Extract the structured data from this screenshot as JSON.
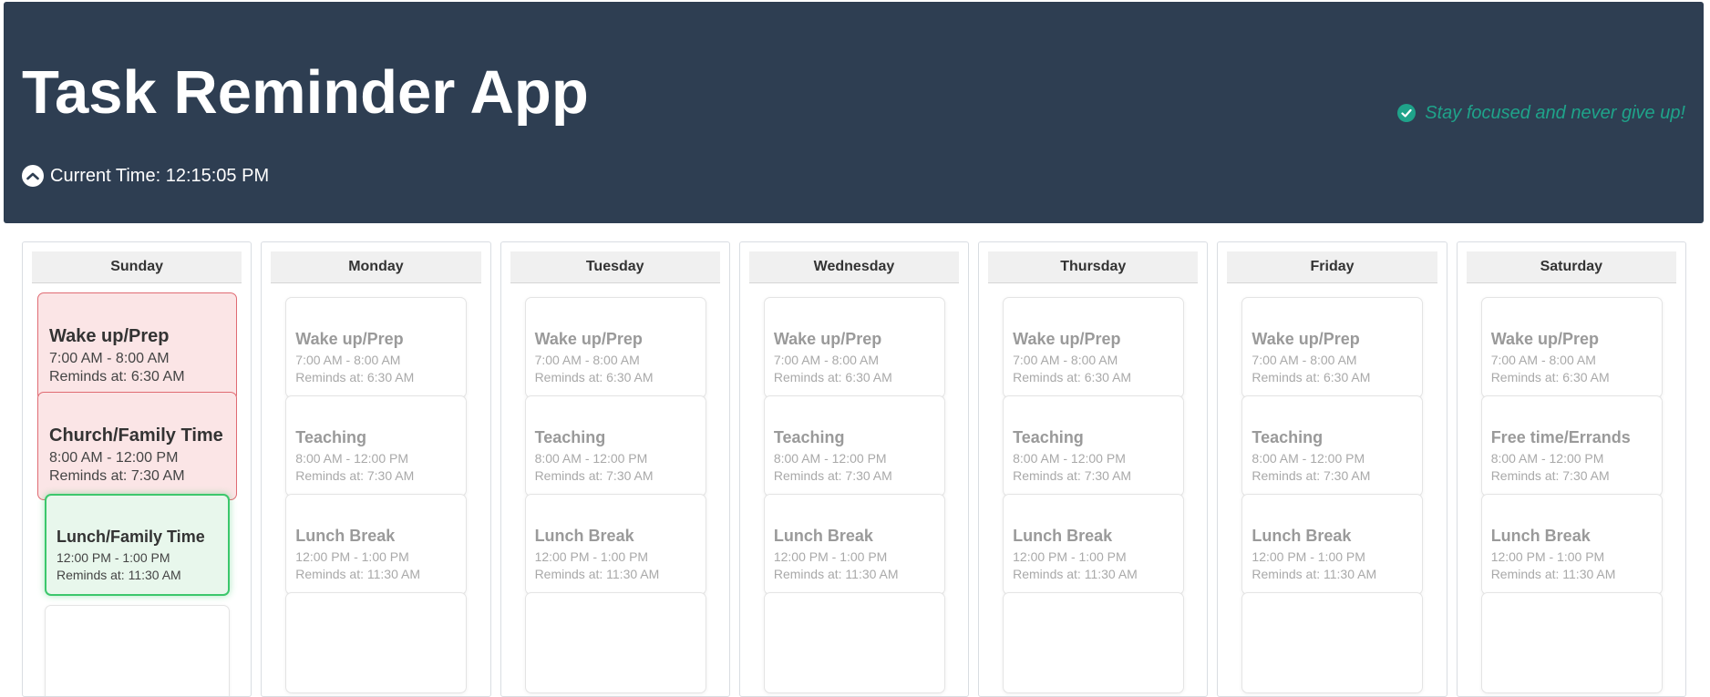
{
  "app": {
    "title": "Task Reminder App",
    "current_time": "Current Time: 12:15:05 PM",
    "motto": "Stay focused and never give up!",
    "icons": {
      "clock": "clock-icon",
      "motto": "check-circle-icon"
    },
    "colors": {
      "header_bg": "#2e3e52",
      "accent": "#1fa38a",
      "past_bg": "#fbe5e6",
      "past_border": "#e06b73",
      "current_bg": "#e8f7ec",
      "current_border": "#3cc76c"
    }
  },
  "days": [
    {
      "name": "Sunday",
      "tasks": [
        {
          "title": "Wake up/Prep",
          "time": "7:00 AM - 8:00 AM",
          "reminder": "Reminds at: 6:30 AM",
          "status": "past"
        },
        {
          "title": "Church/Family Time",
          "time": "8:00 AM - 12:00 PM",
          "reminder": "Reminds at: 7:30 AM",
          "status": "past"
        },
        {
          "title": "Lunch/Family Time",
          "time": "12:00 PM - 1:00 PM",
          "reminder": "Reminds at: 11:30 AM",
          "status": "current"
        }
      ]
    },
    {
      "name": "Monday",
      "tasks": [
        {
          "title": "Wake up/Prep",
          "time": "7:00 AM - 8:00 AM",
          "reminder": "Reminds at: 6:30 AM",
          "status": "inactive"
        },
        {
          "title": "Teaching",
          "time": "8:00 AM - 12:00 PM",
          "reminder": "Reminds at: 7:30 AM",
          "status": "inactive"
        },
        {
          "title": "Lunch Break",
          "time": "12:00 PM - 1:00 PM",
          "reminder": "Reminds at: 11:30 AM",
          "status": "inactive"
        }
      ]
    },
    {
      "name": "Tuesday",
      "tasks": [
        {
          "title": "Wake up/Prep",
          "time": "7:00 AM - 8:00 AM",
          "reminder": "Reminds at: 6:30 AM",
          "status": "inactive"
        },
        {
          "title": "Teaching",
          "time": "8:00 AM - 12:00 PM",
          "reminder": "Reminds at: 7:30 AM",
          "status": "inactive"
        },
        {
          "title": "Lunch Break",
          "time": "12:00 PM - 1:00 PM",
          "reminder": "Reminds at: 11:30 AM",
          "status": "inactive"
        }
      ]
    },
    {
      "name": "Wednesday",
      "tasks": [
        {
          "title": "Wake up/Prep",
          "time": "7:00 AM - 8:00 AM",
          "reminder": "Reminds at: 6:30 AM",
          "status": "inactive"
        },
        {
          "title": "Teaching",
          "time": "8:00 AM - 12:00 PM",
          "reminder": "Reminds at: 7:30 AM",
          "status": "inactive"
        },
        {
          "title": "Lunch Break",
          "time": "12:00 PM - 1:00 PM",
          "reminder": "Reminds at: 11:30 AM",
          "status": "inactive"
        }
      ]
    },
    {
      "name": "Thursday",
      "tasks": [
        {
          "title": "Wake up/Prep",
          "time": "7:00 AM - 8:00 AM",
          "reminder": "Reminds at: 6:30 AM",
          "status": "inactive"
        },
        {
          "title": "Teaching",
          "time": "8:00 AM - 12:00 PM",
          "reminder": "Reminds at: 7:30 AM",
          "status": "inactive"
        },
        {
          "title": "Lunch Break",
          "time": "12:00 PM - 1:00 PM",
          "reminder": "Reminds at: 11:30 AM",
          "status": "inactive"
        }
      ]
    },
    {
      "name": "Friday",
      "tasks": [
        {
          "title": "Wake up/Prep",
          "time": "7:00 AM - 8:00 AM",
          "reminder": "Reminds at: 6:30 AM",
          "status": "inactive"
        },
        {
          "title": "Teaching",
          "time": "8:00 AM - 12:00 PM",
          "reminder": "Reminds at: 7:30 AM",
          "status": "inactive"
        },
        {
          "title": "Lunch Break",
          "time": "12:00 PM - 1:00 PM",
          "reminder": "Reminds at: 11:30 AM",
          "status": "inactive"
        }
      ]
    },
    {
      "name": "Saturday",
      "tasks": [
        {
          "title": "Wake up/Prep",
          "time": "7:00 AM - 8:00 AM",
          "reminder": "Reminds at: 6:30 AM",
          "status": "inactive"
        },
        {
          "title": "Free time/Errands",
          "time": "8:00 AM - 12:00 PM",
          "reminder": "Reminds at: 7:30 AM",
          "status": "inactive"
        },
        {
          "title": "Lunch Break",
          "time": "12:00 PM - 1:00 PM",
          "reminder": "Reminds at: 11:30 AM",
          "status": "inactive"
        }
      ]
    }
  ]
}
